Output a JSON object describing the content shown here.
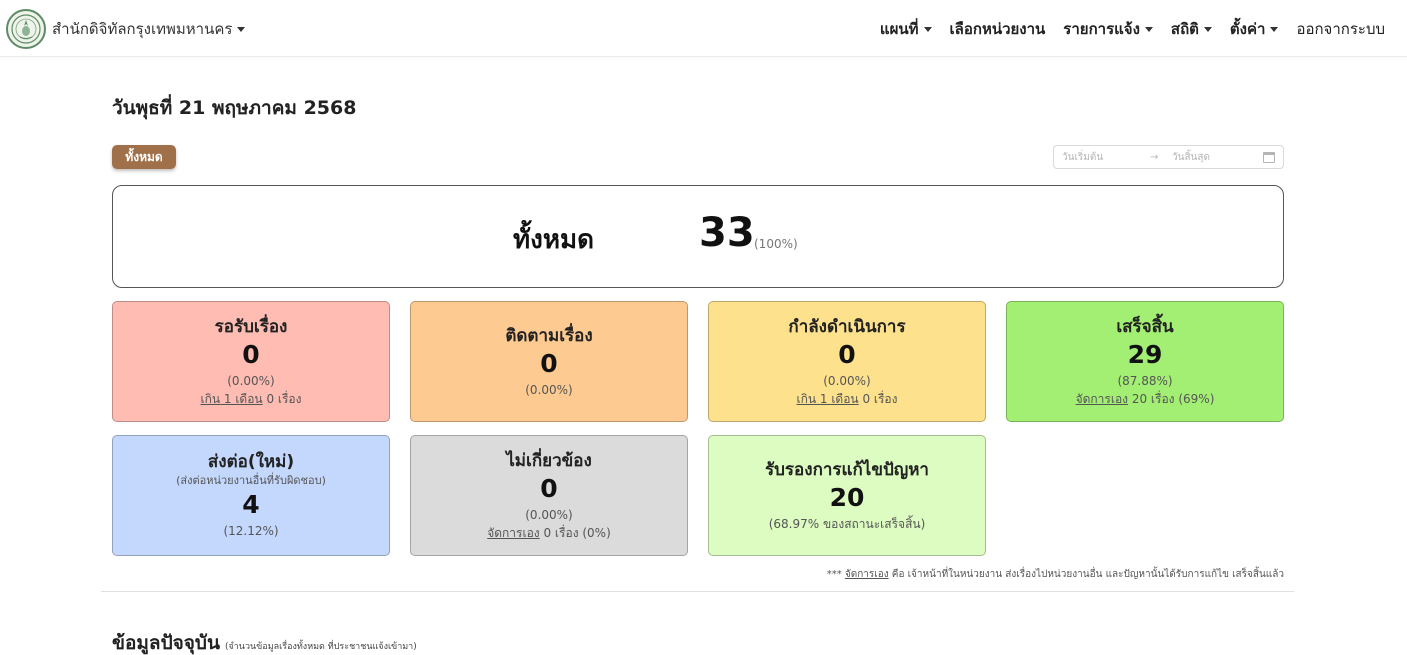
{
  "navbar": {
    "brand": "สำนักดิจิทัลกรุงเทพมหานคร",
    "items": [
      {
        "label": "แผนที่",
        "dropdown": true
      },
      {
        "label": "เลือกหน่วยงาน",
        "dropdown": false
      },
      {
        "label": "รายการแจ้ง",
        "dropdown": true
      },
      {
        "label": "สถิติ",
        "dropdown": true
      },
      {
        "label": "ตั้งค่า",
        "dropdown": true
      },
      {
        "label": "ออกจากระบบ",
        "dropdown": false
      }
    ]
  },
  "date_title": "วันพุธที่ 21 พฤษภาคม 2568",
  "filter": {
    "all_button": "ทั้งหมด",
    "start_placeholder": "วันเริ่มต้น",
    "arrow": "→",
    "end_placeholder": "วันสิ้นสุด"
  },
  "total": {
    "label": "ทั้งหมด",
    "value": "33",
    "pct": "(100%)"
  },
  "cards": {
    "pending": {
      "title": "รอรับเรื่อง",
      "value": "0",
      "pct": "(0.00%)",
      "extra_link": "เกิน 1 เดือน",
      "extra_text": " 0 เรื่อง"
    },
    "follow": {
      "title": "ติดตามเรื่อง",
      "value": "0",
      "pct": "(0.00%)"
    },
    "in_progress": {
      "title": "กำลังดำเนินการ",
      "value": "0",
      "pct": "(0.00%)",
      "extra_link": "เกิน 1 เดือน",
      "extra_text": " 0 เรื่อง"
    },
    "done": {
      "title": "เสร็จสิ้น",
      "value": "29",
      "pct": "(87.88%)",
      "extra_link": "จัดการเอง",
      "extra_text": " 20 เรื่อง (69%)"
    },
    "forward": {
      "title": "ส่งต่อ(ใหม่)",
      "subtitle": "(ส่งต่อหน่วยงานอื่นที่รับผิดชอบ)",
      "value": "4",
      "pct": "(12.12%)"
    },
    "irrelevant": {
      "title": "ไม่เกี่ยวข้อง",
      "value": "0",
      "pct": "(0.00%)",
      "extra_link": "จัดการเอง",
      "extra_text": " 0 เรื่อง (0%)"
    },
    "certified": {
      "title": "รับรองการแก้ไขปัญหา",
      "value": "20",
      "pct": "(68.97% ของสถานะเสร็จสิ้น)"
    }
  },
  "colors": {
    "pending": "#ffbcb2",
    "follow": "#fdcb92",
    "in_progress": "#fde18c",
    "done": "#a2ef73",
    "forward": "#c4d8fd",
    "irrelevant": "#dbdbdb",
    "certified": "#dcfcc1",
    "all_button": "#a0704a"
  },
  "footnote": {
    "prefix": "*** ",
    "link": "จัดการเอง",
    "text": " คือ เจ้าหน้าที่ในหน่วยงาน ส่งเรื่องไปหน่วยงานอื่น และปัญหานั้นได้รับการแก้ไข เสร็จสิ้นแล้ว"
  },
  "current": {
    "title": "ข้อมูลปัจจุบัน",
    "subtitle": "(จำนวนข้อมูลเรื่องทั้งหมด ที่ประชาชนแจ้งเข้ามา)"
  }
}
